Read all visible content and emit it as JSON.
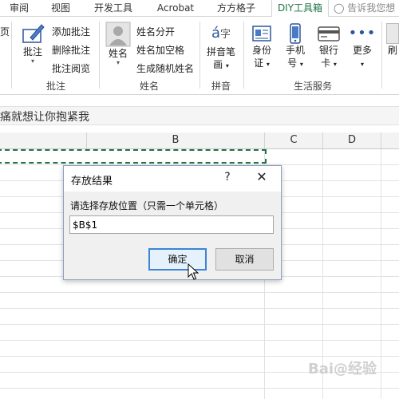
{
  "tabs": [
    "审阅",
    "视图",
    "开发工具",
    "Acrobat",
    "方方格子",
    "DIY工具箱"
  ],
  "tell_me": "告诉我您想",
  "ribbon": {
    "annotate": {
      "big": "批注",
      "small": [
        "添加批注",
        "删除批注",
        "批注阅览"
      ],
      "group": "批注"
    },
    "name": {
      "big": "姓名",
      "small": [
        "姓名分开",
        "姓名加空格",
        "生成随机姓名"
      ],
      "group": "姓名"
    },
    "pinyin": {
      "big_line1": "拼音笔",
      "big_line2": "画",
      "group": "拼音"
    },
    "life": {
      "items": [
        {
          "l1": "身份",
          "l2": "证"
        },
        {
          "l1": "手机",
          "l2": "号"
        },
        {
          "l1": "银行",
          "l2": "卡"
        },
        {
          "l1": "更多",
          "l2": ""
        }
      ],
      "group": "生活服务"
    },
    "left_edge_fragment": "页",
    "right_edge_fragment": "刷"
  },
  "formula_bar": "痛就想让你抱紧我",
  "columns": [
    "B",
    "C",
    "D"
  ],
  "dialog": {
    "title": "存放结果",
    "help": "?",
    "close": "✕",
    "prompt": "请选择存放位置（只需一个单元格）",
    "input_value": "$B$1",
    "ok": "确定",
    "cancel": "取消"
  },
  "watermark": "Bai@经验"
}
